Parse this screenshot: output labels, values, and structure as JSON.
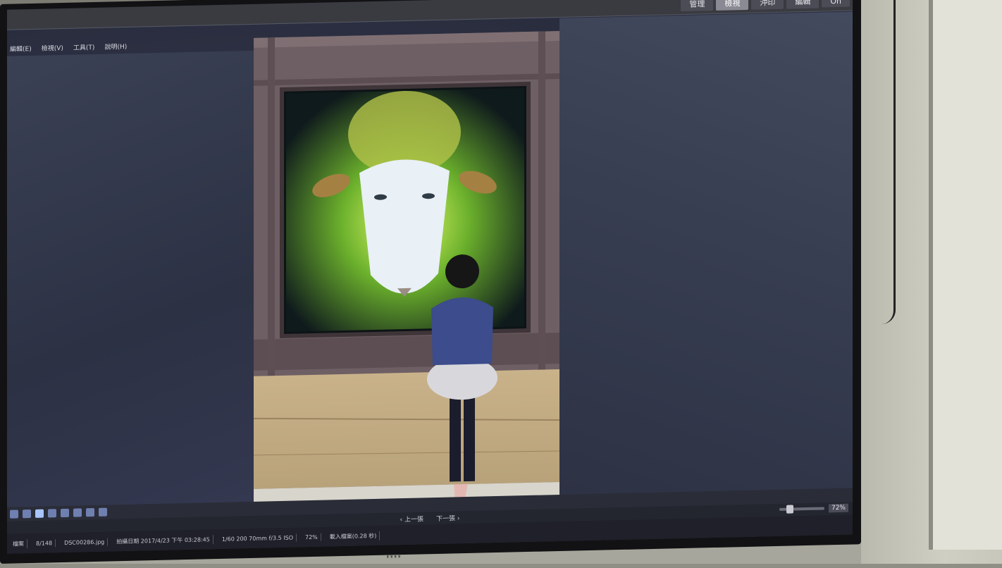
{
  "app": {
    "menu": [
      "編輯(E)",
      "檢視(V)",
      "工具(T)",
      "說明(H)"
    ],
    "modes": [
      {
        "label": "管理",
        "active": false
      },
      {
        "label": "檢視",
        "active": true
      },
      {
        "label": "沖印",
        "active": false
      },
      {
        "label": "編輯",
        "active": false
      },
      {
        "label": "On",
        "active": false
      }
    ]
  },
  "viewer": {
    "nav_prev": "‹ 上一張",
    "nav_next": "下一張 ›",
    "zoom": "72%"
  },
  "status": [
    "檔案",
    "8/148",
    "DSC00286.jpg",
    "拍攝日期 2017/4/23 下午 03:28:45",
    "1/60 200 70mm f/3.5 ISO",
    "72%",
    "載入檔案(0.28 秒)"
  ],
  "colors": {
    "accent": "#a9c4ff",
    "toolbar_bg": "#3a3b41",
    "screen_bg": "#2c3042"
  }
}
